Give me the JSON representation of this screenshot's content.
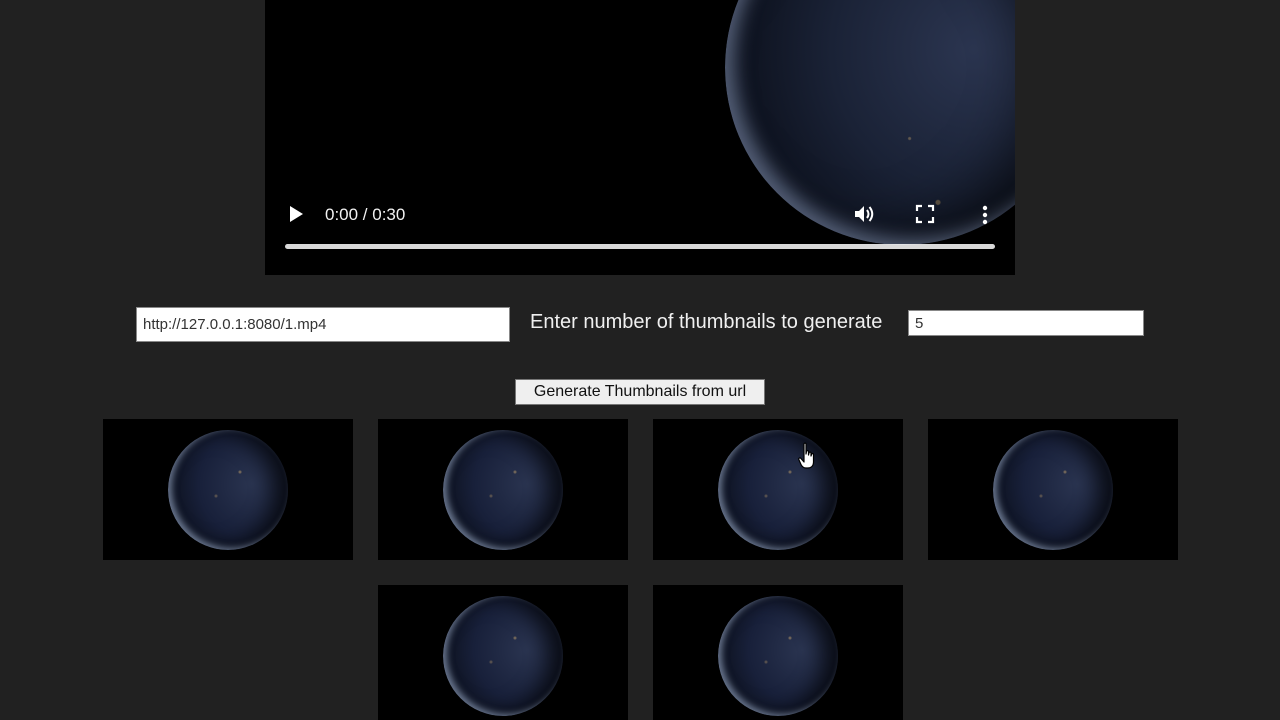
{
  "video": {
    "time_display": "0:00 / 0:30",
    "play_icon": "play-icon",
    "volume_icon": "volume-icon",
    "fullscreen_icon": "fullscreen-icon",
    "more_icon": "more-vert-icon"
  },
  "form": {
    "url_value": "http://127.0.0.1:8080/1.mp4",
    "count_label": "Enter number of thumbnails to generate",
    "count_value": "5",
    "generate_button": "Generate Thumbnails from url"
  },
  "thumbnails": {
    "count": 6
  }
}
